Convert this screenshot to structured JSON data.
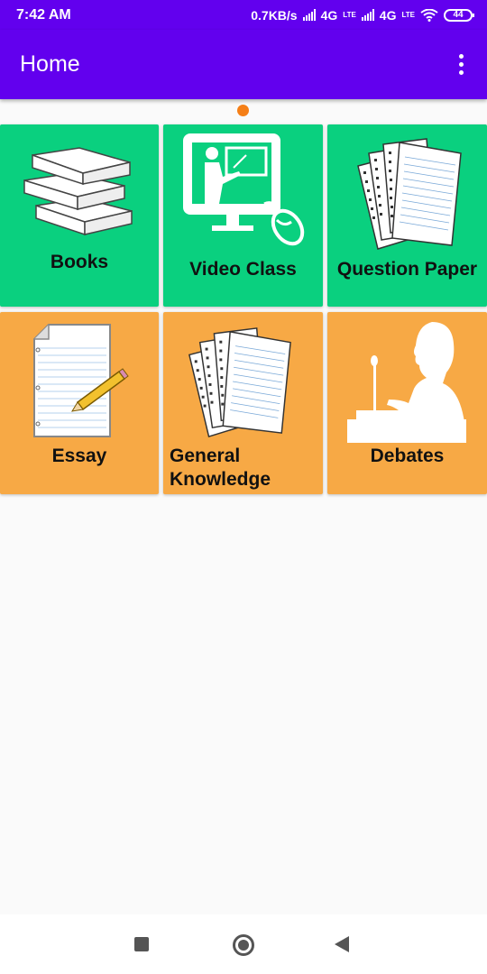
{
  "status_bar": {
    "time": "7:42 AM",
    "speed": "0.7KB/s",
    "network1": "4G",
    "lte1": "LTE",
    "network2": "4G",
    "lte2": "LTE",
    "battery": "44"
  },
  "app_bar": {
    "title": "Home"
  },
  "tiles": [
    {
      "label": "Books",
      "color": "#0ad07f",
      "icon": "books-icon"
    },
    {
      "label": "Video Class",
      "color": "#0ad07f",
      "icon": "video-class-icon"
    },
    {
      "label": "Question Paper",
      "color": "#0ad07f",
      "icon": "question-paper-icon"
    },
    {
      "label": "Essay",
      "color": "#f7a945",
      "icon": "essay-icon"
    },
    {
      "label": "General Knowledge",
      "color": "#f7a945",
      "icon": "general-knowledge-icon"
    },
    {
      "label": "Debates",
      "color": "#f7a945",
      "icon": "debates-icon"
    }
  ],
  "colors": {
    "primary": "#6200ee",
    "tile_green": "#0ad07f",
    "tile_orange": "#f7a945",
    "page_indicator": "#f57f17"
  }
}
